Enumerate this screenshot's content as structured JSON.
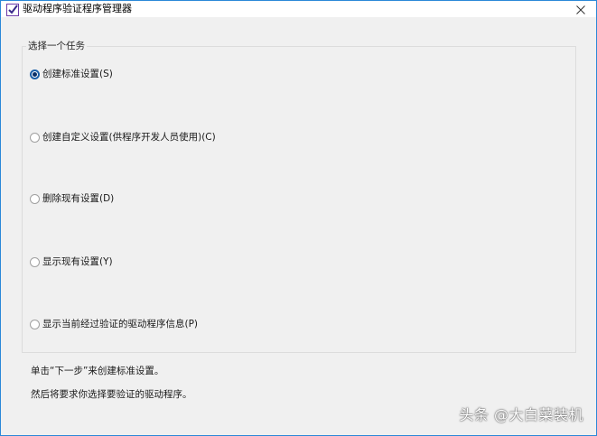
{
  "window": {
    "title": "驱动程序验证程序管理器",
    "app_icon": "checklist-icon",
    "close_icon": "close-icon",
    "accent_color": "#2b88d8"
  },
  "task_group": {
    "legend": "选择一个任务",
    "options": [
      {
        "label": "创建标准设置(S)",
        "selected": true
      },
      {
        "label": "创建自定义设置(供程序开发人员使用)(C)",
        "selected": false
      },
      {
        "label": "删除现有设置(D)",
        "selected": false
      },
      {
        "label": "显示现有设置(Y)",
        "selected": false
      },
      {
        "label": "显示当前经过验证的驱动程序信息(P)",
        "selected": false
      }
    ]
  },
  "info": {
    "line1": "单击“下一步”来创建标准设置。",
    "line2": "然后将要求你选择要验证的驱动程序。"
  },
  "watermark": {
    "text": "头条 @大白菜装机"
  }
}
